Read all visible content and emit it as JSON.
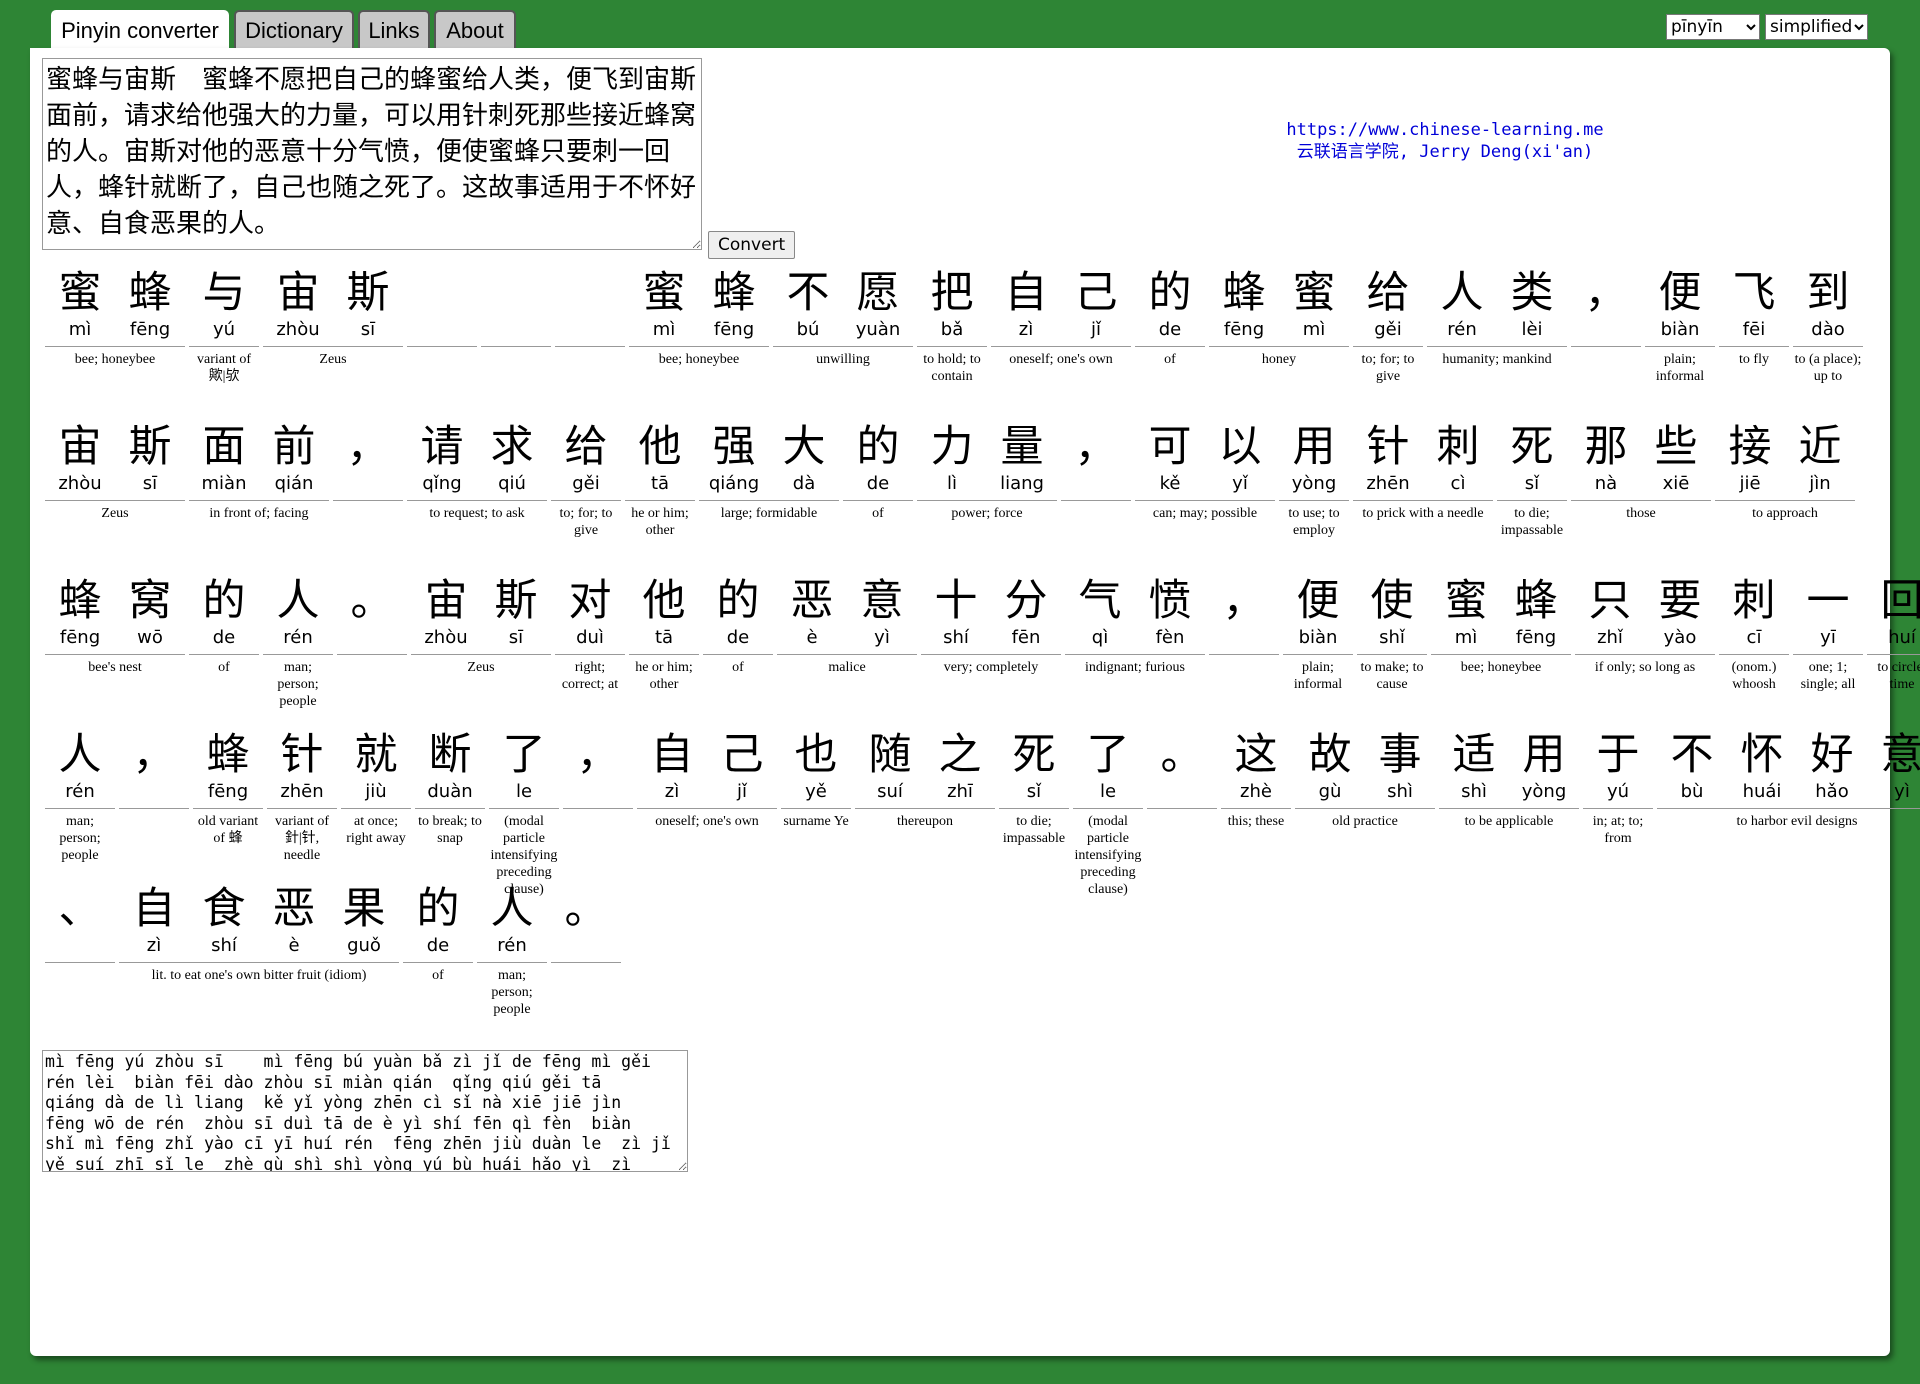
{
  "tabs": [
    "Pinyin converter",
    "Dictionary",
    "Links",
    "About"
  ],
  "selects": {
    "mode_value": "pīnyīn",
    "script_value": "simplified"
  },
  "input": {
    "text": "蜜蜂与宙斯　蜜蜂不愿把自己的蜂蜜给人类，便飞到宙斯面前，请求给他强大的力量，可以用针刺死那些接近蜂窝的人。宙斯对他的恶意十分气愤，便使蜜蜂只要刺一回人，蜂针就断了，自己也随之死了。这故事适用于不怀好意、自食恶果的人。"
  },
  "convert_label": "Convert",
  "credit": {
    "url": "https://www.chinese-learning.me",
    "name": "云联语言学院, Jerry Deng(xi'an)"
  },
  "rows": [
    [
      {
        "chars": [
          [
            "蜜",
            "mì"
          ],
          [
            "蜂",
            "fēng"
          ]
        ],
        "def": "bee; honeybee"
      },
      {
        "chars": [
          [
            "与",
            "yú"
          ]
        ],
        "def": "variant of 歟|欤"
      },
      {
        "chars": [
          [
            "宙",
            "zhòu"
          ],
          [
            "斯",
            "sī"
          ]
        ],
        "def": "Zeus"
      },
      {
        "chars": [
          [
            "",
            ""
          ]
        ],
        "def": ""
      },
      {
        "chars": [
          [
            "",
            ""
          ]
        ],
        "def": ""
      },
      {
        "chars": [
          [
            "",
            ""
          ]
        ],
        "def": ""
      },
      {
        "chars": [
          [
            "蜜",
            "mì"
          ],
          [
            "蜂",
            "fēng"
          ]
        ],
        "def": "bee; honeybee"
      },
      {
        "chars": [
          [
            "不",
            "bú"
          ],
          [
            "愿",
            "yuàn"
          ]
        ],
        "def": "unwilling"
      },
      {
        "chars": [
          [
            "把",
            "bǎ"
          ]
        ],
        "def": "to hold; to contain"
      },
      {
        "chars": [
          [
            "自",
            "zì"
          ],
          [
            "己",
            "jǐ"
          ]
        ],
        "def": "oneself; one's own"
      },
      {
        "chars": [
          [
            "的",
            "de"
          ]
        ],
        "def": "of"
      },
      {
        "chars": [
          [
            "蜂",
            "fēng"
          ],
          [
            "蜜",
            "mì"
          ]
        ],
        "def": "honey"
      },
      {
        "chars": [
          [
            "给",
            "gěi"
          ]
        ],
        "def": "to; for; to give"
      },
      {
        "chars": [
          [
            "人",
            "rén"
          ],
          [
            "类",
            "lèi"
          ]
        ],
        "def": "humanity; mankind"
      },
      {
        "chars": [
          [
            "，",
            ""
          ]
        ],
        "def": ""
      },
      {
        "chars": [
          [
            "便",
            "biàn"
          ]
        ],
        "def": "plain; informal"
      },
      {
        "chars": [
          [
            "飞",
            "fēi"
          ]
        ],
        "def": "to fly"
      },
      {
        "chars": [
          [
            "到",
            "dào"
          ]
        ],
        "def": "to (a place); up to"
      }
    ],
    [
      {
        "chars": [
          [
            "宙",
            "zhòu"
          ],
          [
            "斯",
            "sī"
          ]
        ],
        "def": "Zeus"
      },
      {
        "chars": [
          [
            "面",
            "miàn"
          ],
          [
            "前",
            "qián"
          ]
        ],
        "def": "in front of; facing"
      },
      {
        "chars": [
          [
            "，",
            ""
          ]
        ],
        "def": ""
      },
      {
        "chars": [
          [
            "请",
            "qǐng"
          ],
          [
            "求",
            "qiú"
          ]
        ],
        "def": "to request; to ask"
      },
      {
        "chars": [
          [
            "给",
            "gěi"
          ]
        ],
        "def": "to; for; to give"
      },
      {
        "chars": [
          [
            "他",
            "tā"
          ]
        ],
        "def": "he or him; other"
      },
      {
        "chars": [
          [
            "强",
            "qiáng"
          ],
          [
            "大",
            "dà"
          ]
        ],
        "def": "large; formidable"
      },
      {
        "chars": [
          [
            "的",
            "de"
          ]
        ],
        "def": "of"
      },
      {
        "chars": [
          [
            "力",
            "lì"
          ],
          [
            "量",
            "liang"
          ]
        ],
        "def": "power; force"
      },
      {
        "chars": [
          [
            "，",
            ""
          ]
        ],
        "def": ""
      },
      {
        "chars": [
          [
            "可",
            "kě"
          ],
          [
            "以",
            "yǐ"
          ]
        ],
        "def": "can; may; possible"
      },
      {
        "chars": [
          [
            "用",
            "yòng"
          ]
        ],
        "def": "to use; to employ"
      },
      {
        "chars": [
          [
            "针",
            "zhēn"
          ],
          [
            "刺",
            "cì"
          ]
        ],
        "def": "to prick with a needle"
      },
      {
        "chars": [
          [
            "死",
            "sǐ"
          ]
        ],
        "def": "to die; impassable"
      },
      {
        "chars": [
          [
            "那",
            "nà"
          ],
          [
            "些",
            "xiē"
          ]
        ],
        "def": "those"
      },
      {
        "chars": [
          [
            "接",
            "jiē"
          ],
          [
            "近",
            "jìn"
          ]
        ],
        "def": "to approach"
      }
    ],
    [
      {
        "chars": [
          [
            "蜂",
            "fēng"
          ],
          [
            "窝",
            "wō"
          ]
        ],
        "def": "bee's nest"
      },
      {
        "chars": [
          [
            "的",
            "de"
          ]
        ],
        "def": "of"
      },
      {
        "chars": [
          [
            "人",
            "rén"
          ]
        ],
        "def": "man; person; people"
      },
      {
        "chars": [
          [
            "。",
            ""
          ]
        ],
        "def": ""
      },
      {
        "chars": [
          [
            "宙",
            "zhòu"
          ],
          [
            "斯",
            "sī"
          ]
        ],
        "def": "Zeus"
      },
      {
        "chars": [
          [
            "对",
            "duì"
          ]
        ],
        "def": "right; correct; at"
      },
      {
        "chars": [
          [
            "他",
            "tā"
          ]
        ],
        "def": "he or him; other"
      },
      {
        "chars": [
          [
            "的",
            "de"
          ]
        ],
        "def": "of"
      },
      {
        "chars": [
          [
            "恶",
            "è"
          ],
          [
            "意",
            "yì"
          ]
        ],
        "def": "malice"
      },
      {
        "chars": [
          [
            "十",
            "shí"
          ],
          [
            "分",
            "fēn"
          ]
        ],
        "def": "very; completely"
      },
      {
        "chars": [
          [
            "气",
            "qì"
          ],
          [
            "愤",
            "fèn"
          ]
        ],
        "def": "indignant; furious"
      },
      {
        "chars": [
          [
            "，",
            ""
          ]
        ],
        "def": ""
      },
      {
        "chars": [
          [
            "便",
            "biàn"
          ]
        ],
        "def": "plain; informal"
      },
      {
        "chars": [
          [
            "使",
            "shǐ"
          ]
        ],
        "def": "to make; to cause"
      },
      {
        "chars": [
          [
            "蜜",
            "mì"
          ],
          [
            "蜂",
            "fēng"
          ]
        ],
        "def": "bee; honeybee"
      },
      {
        "chars": [
          [
            "只",
            "zhǐ"
          ],
          [
            "要",
            "yào"
          ]
        ],
        "def": "if only; so long as"
      },
      {
        "chars": [
          [
            "刺",
            "cī"
          ]
        ],
        "def": "(onom.) whoosh"
      },
      {
        "chars": [
          [
            "一",
            "yī"
          ]
        ],
        "def": "one; 1; single; all"
      },
      {
        "chars": [
          [
            "回",
            "huí"
          ]
        ],
        "def": "to circle; time"
      }
    ],
    [
      {
        "chars": [
          [
            "人",
            "rén"
          ]
        ],
        "def": "man; person; people"
      },
      {
        "chars": [
          [
            "，",
            ""
          ]
        ],
        "def": ""
      },
      {
        "chars": [
          [
            "蜂",
            "fēng"
          ]
        ],
        "def": "old variant of 蜂"
      },
      {
        "chars": [
          [
            "针",
            "zhēn"
          ]
        ],
        "def": "variant of 針|针, needle"
      },
      {
        "chars": [
          [
            "就",
            "jiù"
          ]
        ],
        "def": "at once; right away"
      },
      {
        "chars": [
          [
            "断",
            "duàn"
          ]
        ],
        "def": "to break; to snap"
      },
      {
        "chars": [
          [
            "了",
            "le"
          ]
        ],
        "def": "(modal particle intensifying preceding clause)"
      },
      {
        "chars": [
          [
            "，",
            ""
          ]
        ],
        "def": ""
      },
      {
        "chars": [
          [
            "自",
            "zì"
          ],
          [
            "己",
            "jǐ"
          ]
        ],
        "def": "oneself; one's own"
      },
      {
        "chars": [
          [
            "也",
            "yě"
          ]
        ],
        "def": "surname Ye"
      },
      {
        "chars": [
          [
            "随",
            "suí"
          ],
          [
            "之",
            "zhī"
          ]
        ],
        "def": "thereupon"
      },
      {
        "chars": [
          [
            "死",
            "sǐ"
          ]
        ],
        "def": "to die; impassable"
      },
      {
        "chars": [
          [
            "了",
            "le"
          ]
        ],
        "def": "(modal particle intensifying preceding clause)"
      },
      {
        "chars": [
          [
            "。",
            ""
          ]
        ],
        "def": ""
      },
      {
        "chars": [
          [
            "这",
            "zhè"
          ]
        ],
        "def": "this; these"
      },
      {
        "chars": [
          [
            "故",
            "gù"
          ],
          [
            "事",
            "shì"
          ]
        ],
        "def": "old practice"
      },
      {
        "chars": [
          [
            "适",
            "shì"
          ],
          [
            "用",
            "yòng"
          ]
        ],
        "def": "to be applicable"
      },
      {
        "chars": [
          [
            "于",
            "yú"
          ]
        ],
        "def": "in; at; to; from"
      },
      {
        "chars": [
          [
            "不",
            "bù"
          ],
          [
            "怀",
            "huái"
          ],
          [
            "好",
            "hǎo"
          ],
          [
            "意",
            "yì"
          ]
        ],
        "def": "to harbor evil designs"
      }
    ],
    [
      {
        "chars": [
          [
            "、",
            ""
          ]
        ],
        "def": ""
      },
      {
        "chars": [
          [
            "自",
            "zì"
          ],
          [
            "食",
            "shí"
          ],
          [
            "恶",
            "è"
          ],
          [
            "果",
            "guǒ"
          ]
        ],
        "def": "lit. to eat one's own bitter fruit (idiom)"
      },
      {
        "chars": [
          [
            "的",
            "de"
          ]
        ],
        "def": "of"
      },
      {
        "chars": [
          [
            "人",
            "rén"
          ]
        ],
        "def": "man; person; people"
      },
      {
        "chars": [
          [
            "。",
            ""
          ]
        ],
        "def": ""
      }
    ]
  ],
  "output": {
    "text": "mì fēng yú zhòu sī    mì fēng bú yuàn bǎ zì jǐ de fēng mì gěi\nrén lèi  biàn fēi dào zhòu sī miàn qián  qǐng qiú gěi tā\nqiáng dà de lì liang  kě yǐ yòng zhēn cì sǐ nà xiē jiē jìn\nfēng wō de rén  zhòu sī duì tā de è yì shí fēn qì fèn  biàn\nshǐ mì fēng zhǐ yào cī yī huí rén  fēng zhēn jiù duàn le  zì jǐ\nyě suí zhī sǐ le  zhè gù shì shì yòng yú bù huái hǎo yì  zì"
  }
}
